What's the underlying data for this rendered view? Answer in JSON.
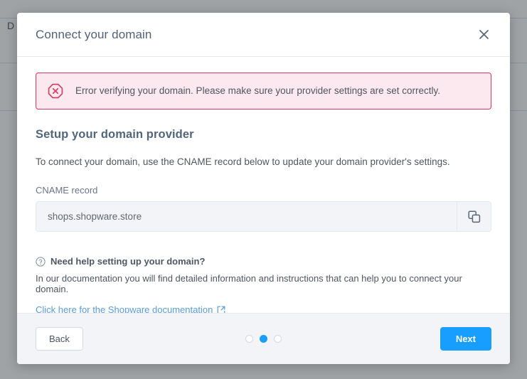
{
  "background": {
    "partial_text": "D",
    "row_line_positions": [
      25,
      88,
      155
    ]
  },
  "modal": {
    "title": "Connect your domain",
    "close_icon": "close-icon",
    "alert": {
      "icon": "error-octagon-icon",
      "message": "Error verifying your domain. Please make sure your provider settings are set correctly.",
      "type": "error",
      "background_color": "#fce9ef",
      "border_color": "#d8375e"
    },
    "section": {
      "heading": "Setup your domain provider",
      "description": "To connect your domain, use the CNAME record below to update your domain provider's settings."
    },
    "cname_field": {
      "label": "CNAME record",
      "value": "shops.shopware.store",
      "copy_icon": "copy-icon"
    },
    "help": {
      "icon": "question-circle-icon",
      "title": "Need help setting up your domain?",
      "description": "In our documentation you will find detailed information and instructions that can help you to connect your domain.",
      "link_text": "Click here for the Shopware documentation",
      "link_icon": "external-link-icon",
      "link_color": "#5a9bd8"
    },
    "footer": {
      "back_label": "Back",
      "next_label": "Next",
      "steps": [
        {
          "index": 1,
          "active": false
        },
        {
          "index": 2,
          "active": true
        },
        {
          "index": 3,
          "active": false
        }
      ],
      "accent_color": "#189eff"
    }
  }
}
